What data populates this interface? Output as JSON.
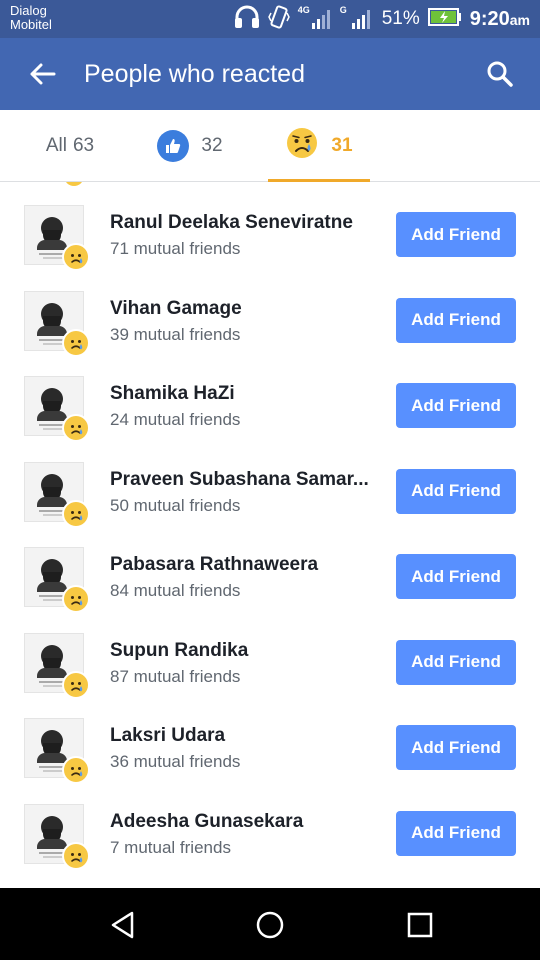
{
  "status_bar": {
    "carrier_line1": "Dialog",
    "carrier_line2": "Mobitel",
    "network_4g": "4G",
    "network_g": "G",
    "battery_percent": "51%",
    "time": "9:20",
    "time_suffix": "am"
  },
  "header": {
    "title": "People who reacted",
    "back_icon": "arrow-left-icon",
    "search_icon": "search-icon"
  },
  "tabs": {
    "all": {
      "label": "All",
      "count": "63"
    },
    "like": {
      "count": "32",
      "icon": "thumbs-up-icon"
    },
    "sad": {
      "count": "31",
      "icon": "sad-face-icon",
      "active": true
    }
  },
  "colors": {
    "status_bar": "#3b5998",
    "app_bar": "#4267b2",
    "add_button": "#5890ff",
    "active_tab": "#f0a92a",
    "like_blue": "#3b7ddd",
    "sad_yellow": "#f7c843"
  },
  "people": [
    {
      "name": "Ranul Deelaka Seneviratne",
      "mutual": "71 mutual friends",
      "button": "Add Friend"
    },
    {
      "name": "Vihan Gamage",
      "mutual": "39 mutual friends",
      "button": "Add Friend"
    },
    {
      "name": "Shamika HaZi",
      "mutual": "24 mutual friends",
      "button": "Add Friend"
    },
    {
      "name": "Praveen Subashana Samar...",
      "mutual": "50 mutual friends",
      "button": "Add Friend"
    },
    {
      "name": "Pabasara Rathnaweera",
      "mutual": "84 mutual friends",
      "button": "Add Friend"
    },
    {
      "name": "Supun Randika",
      "mutual": "87 mutual friends",
      "button": "Add Friend"
    },
    {
      "name": "Laksri Udara",
      "mutual": "36 mutual friends",
      "button": "Add Friend"
    },
    {
      "name": "Adeesha Gunasekara",
      "mutual": "7 mutual friends",
      "button": "Add Friend"
    }
  ],
  "nav": {
    "back_icon": "nav-back-icon",
    "home_icon": "nav-home-icon",
    "recents_icon": "nav-recents-icon"
  }
}
